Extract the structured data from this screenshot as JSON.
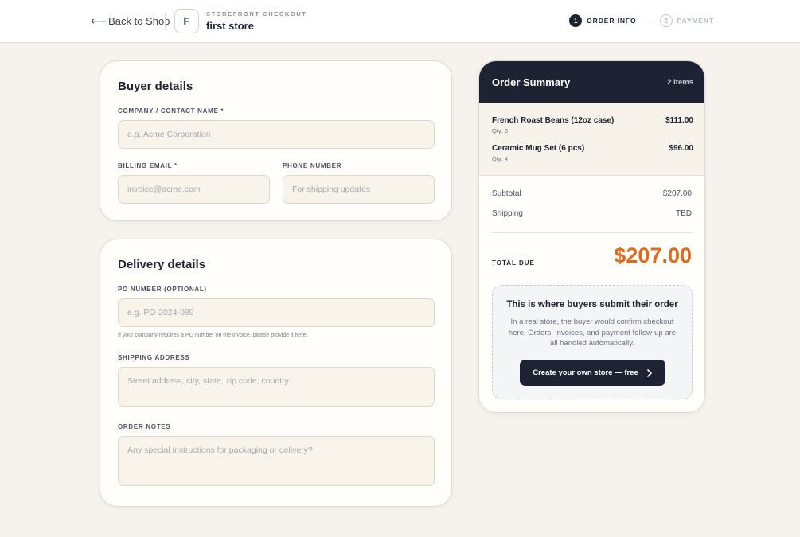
{
  "header": {
    "back_label": "Back to Shop",
    "back_arrow": "⟵",
    "store_initial": "F",
    "store_kicker": "STOREFRONT CHECKOUT",
    "store_name": "first store",
    "steps": [
      {
        "num": "1",
        "label": "ORDER INFO",
        "active": true
      },
      {
        "num": "2",
        "label": "PAYMENT",
        "active": false
      }
    ]
  },
  "buyer": {
    "title": "Buyer details",
    "company_label": "COMPANY / CONTACT NAME *",
    "company_placeholder": "e.g. Acme Corporation",
    "email_label": "BILLING EMAIL *",
    "email_placeholder": "invoice@acme.com",
    "phone_label": "PHONE NUMBER",
    "phone_placeholder": "For shipping updates"
  },
  "delivery": {
    "title": "Delivery details",
    "po_label": "PO NUMBER (OPTIONAL)",
    "po_placeholder": "e.g. PO-2024-089",
    "po_help": "If your company requires a PO number on the invoice, please provide it here.",
    "address_label": "SHIPPING ADDRESS",
    "address_placeholder": "Street address, city, state, zip code, country",
    "notes_label": "ORDER NOTES",
    "notes_placeholder": "Any special instructions for packaging or delivery?"
  },
  "summary": {
    "title": "Order Summary",
    "count": "2 Items",
    "items": [
      {
        "name": "French Roast Beans (12oz case)",
        "qty": "Qty: 6",
        "price": "$111.00"
      },
      {
        "name": "Ceramic Mug Set (6 pcs)",
        "qty": "Qty: 4",
        "price": "$96.00"
      }
    ],
    "subtotal_label": "Subtotal",
    "subtotal_value": "$207.00",
    "shipping_label": "Shipping",
    "shipping_value": "TBD",
    "total_label": "TOTAL DUE",
    "total_value": "$207.00",
    "promo_title": "This is where buyers submit their order",
    "promo_body": "In a real store, the buyer would confirm checkout here. Orders, invoices, and payment follow-up are all handled automatically.",
    "promo_button": "Create your own store — free",
    "promo_button_icon": "chevron-right-icon"
  },
  "colors": {
    "accent_total": "#dd6b1c",
    "dark": "#1d2332",
    "background": "#f6f3ee"
  }
}
